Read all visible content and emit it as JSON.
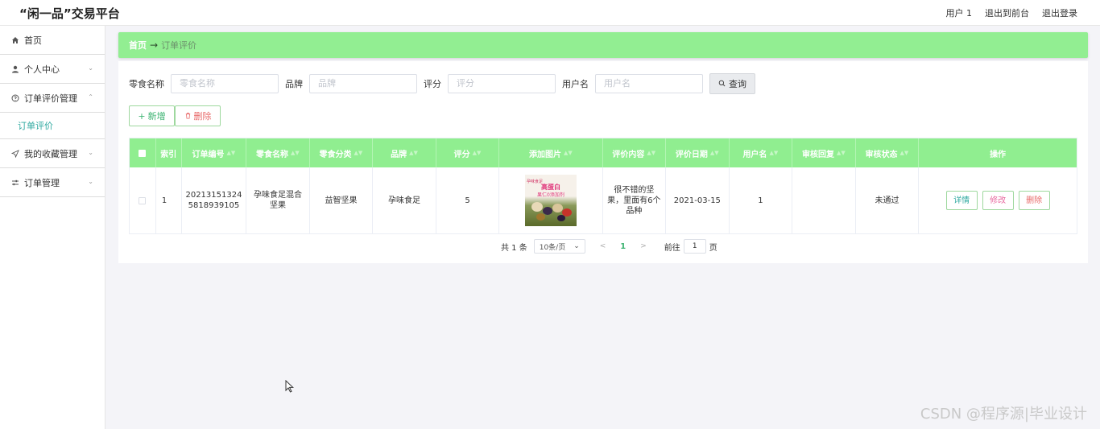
{
  "app": {
    "title": "“闲一品”交易平台",
    "top_links": [
      "用户 1",
      "退出到前台",
      "退出登录"
    ]
  },
  "sidebar": {
    "items": [
      {
        "label": "首页",
        "icon": "home-icon",
        "expandable": false
      },
      {
        "label": "个人中心",
        "icon": "user-icon",
        "expandable": true
      },
      {
        "label": "订单评价管理",
        "icon": "help-circle-icon",
        "expandable": true,
        "expanded": true
      },
      {
        "label": "我的收藏管理",
        "icon": "send-icon",
        "expandable": true
      },
      {
        "label": "订单管理",
        "icon": "sliders-icon",
        "expandable": true
      }
    ],
    "submenu": {
      "label": "订单评价"
    }
  },
  "breadcrumb": {
    "home": "首页",
    "arrow": "→",
    "current": "订单评价"
  },
  "search": {
    "fields": [
      {
        "label": "零食名称",
        "placeholder": "零食名称"
      },
      {
        "label": "品牌",
        "placeholder": "品牌"
      },
      {
        "label": "评分",
        "placeholder": "评分"
      },
      {
        "label": "用户名",
        "placeholder": "用户名"
      }
    ],
    "button_label": "查询"
  },
  "actions": {
    "add_label": "新增",
    "delete_label": "删除"
  },
  "table": {
    "columns": [
      "索引",
      "订单编号",
      "零食名称",
      "零食分类",
      "品牌",
      "评分",
      "添加图片",
      "评价内容",
      "评价日期",
      "用户名",
      "审核回复",
      "审核状态",
      "操作"
    ],
    "rows": [
      {
        "index": "1",
        "order_no": "202131513245818939105",
        "snack_name": "孕味食足混合坚果",
        "category": "益智坚果",
        "brand": "孕味食足",
        "score": "5",
        "image_text": {
          "small": "孕味食足",
          "main": "高蛋白",
          "sub": "果仁0添加剂"
        },
        "content": "很不错的坚果，里面有6个品种",
        "date": "2021-03-15",
        "username": "1",
        "reply": "",
        "status": "未通过"
      }
    ],
    "row_actions": [
      "详情",
      "修改",
      "删除"
    ]
  },
  "pagination": {
    "total": "共 1 条",
    "page_size": "10条/页",
    "current_page": "1",
    "goto_label": "前往",
    "goto_value": "1",
    "page_suffix": "页"
  },
  "watermark": "CSDN @程序源|毕业设计",
  "colors": {
    "accent": "#90ee90",
    "teal": "#2fa9a0",
    "danger": "#e86a6a"
  }
}
